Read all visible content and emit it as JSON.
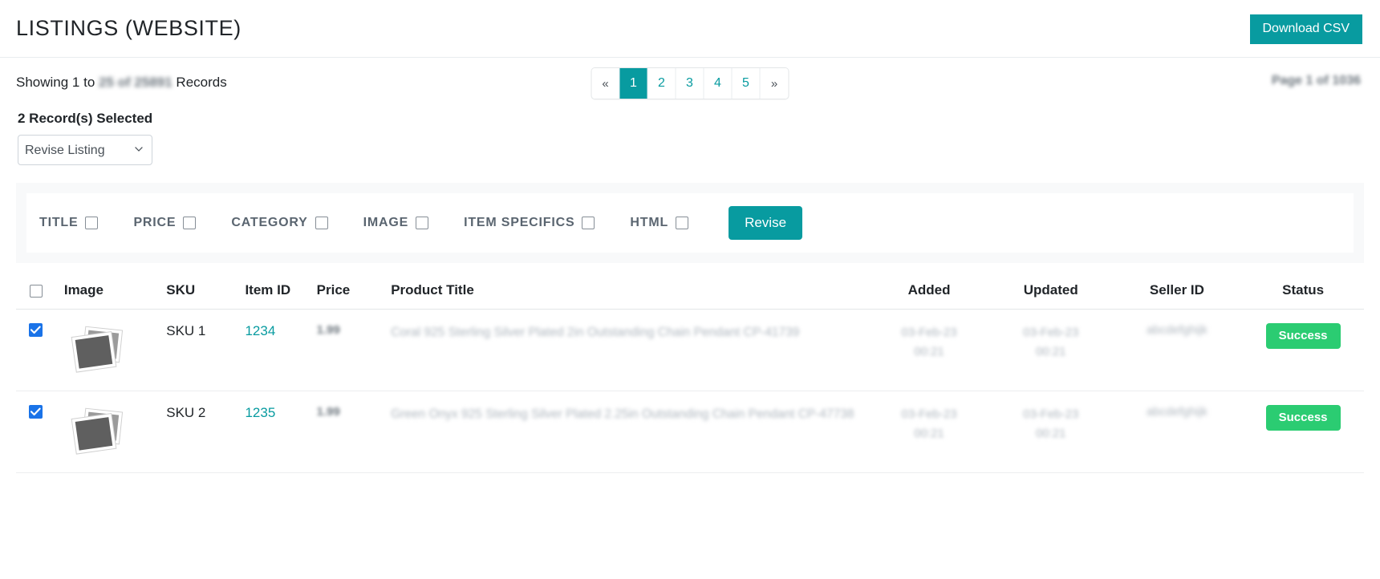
{
  "header": {
    "title": "LISTINGS (WEBSITE)",
    "download_csv_label": "Download CSV",
    "accent_color": "#089ba0"
  },
  "info_bar": {
    "showing_prefix": "Showing 1 to ",
    "showing_range": "25 of 25891",
    "showing_suffix": " Records",
    "page_count_text": "Page 1 of 1036"
  },
  "pagination": {
    "prev_label": "«",
    "next_label": "»",
    "pages": [
      "1",
      "2",
      "3",
      "4",
      "5"
    ],
    "active_page": "1"
  },
  "selection": {
    "selected_label": "2 Record(s) Selected",
    "action_value": "Revise Listing",
    "action_options": [
      "Revise Listing"
    ]
  },
  "revise_panel": {
    "options": [
      {
        "label": "TITLE",
        "checked": false
      },
      {
        "label": "PRICE",
        "checked": false
      },
      {
        "label": "CATEGORY",
        "checked": false
      },
      {
        "label": "IMAGE",
        "checked": false
      },
      {
        "label": "ITEM SPECIFICS",
        "checked": false
      },
      {
        "label": "HTML",
        "checked": false
      }
    ],
    "submit_label": "Revise"
  },
  "table": {
    "headers": {
      "select_all": "",
      "image": "Image",
      "sku": "SKU",
      "item_id": "Item ID",
      "price": "Price",
      "product_title": "Product Title",
      "added": "Added",
      "updated": "Updated",
      "seller_id": "Seller ID",
      "status": "Status"
    },
    "rows": [
      {
        "checked": true,
        "image": "photo-placeholder",
        "sku": "SKU 1",
        "item_id": "1234",
        "price": "1.99",
        "product_title": "Coral 925 Sterling Silver Plated 2in Outstanding Chain Pendant CP-41739",
        "added_date": "03-Feb-23",
        "added_time": "00:21",
        "updated_date": "03-Feb-23",
        "updated_time": "00:21",
        "seller_id": "abcdefghijk",
        "status": "Success"
      },
      {
        "checked": true,
        "image": "photo-placeholder",
        "sku": "SKU 2",
        "item_id": "1235",
        "price": "1.99",
        "product_title": "Green Onyx 925 Sterling Silver Plated 2.25in Outstanding Chain Pendant CP-47738",
        "added_date": "03-Feb-23",
        "added_time": "00:21",
        "updated_date": "03-Feb-23",
        "updated_time": "00:21",
        "seller_id": "abcdefghijk",
        "status": "Success"
      }
    ]
  }
}
